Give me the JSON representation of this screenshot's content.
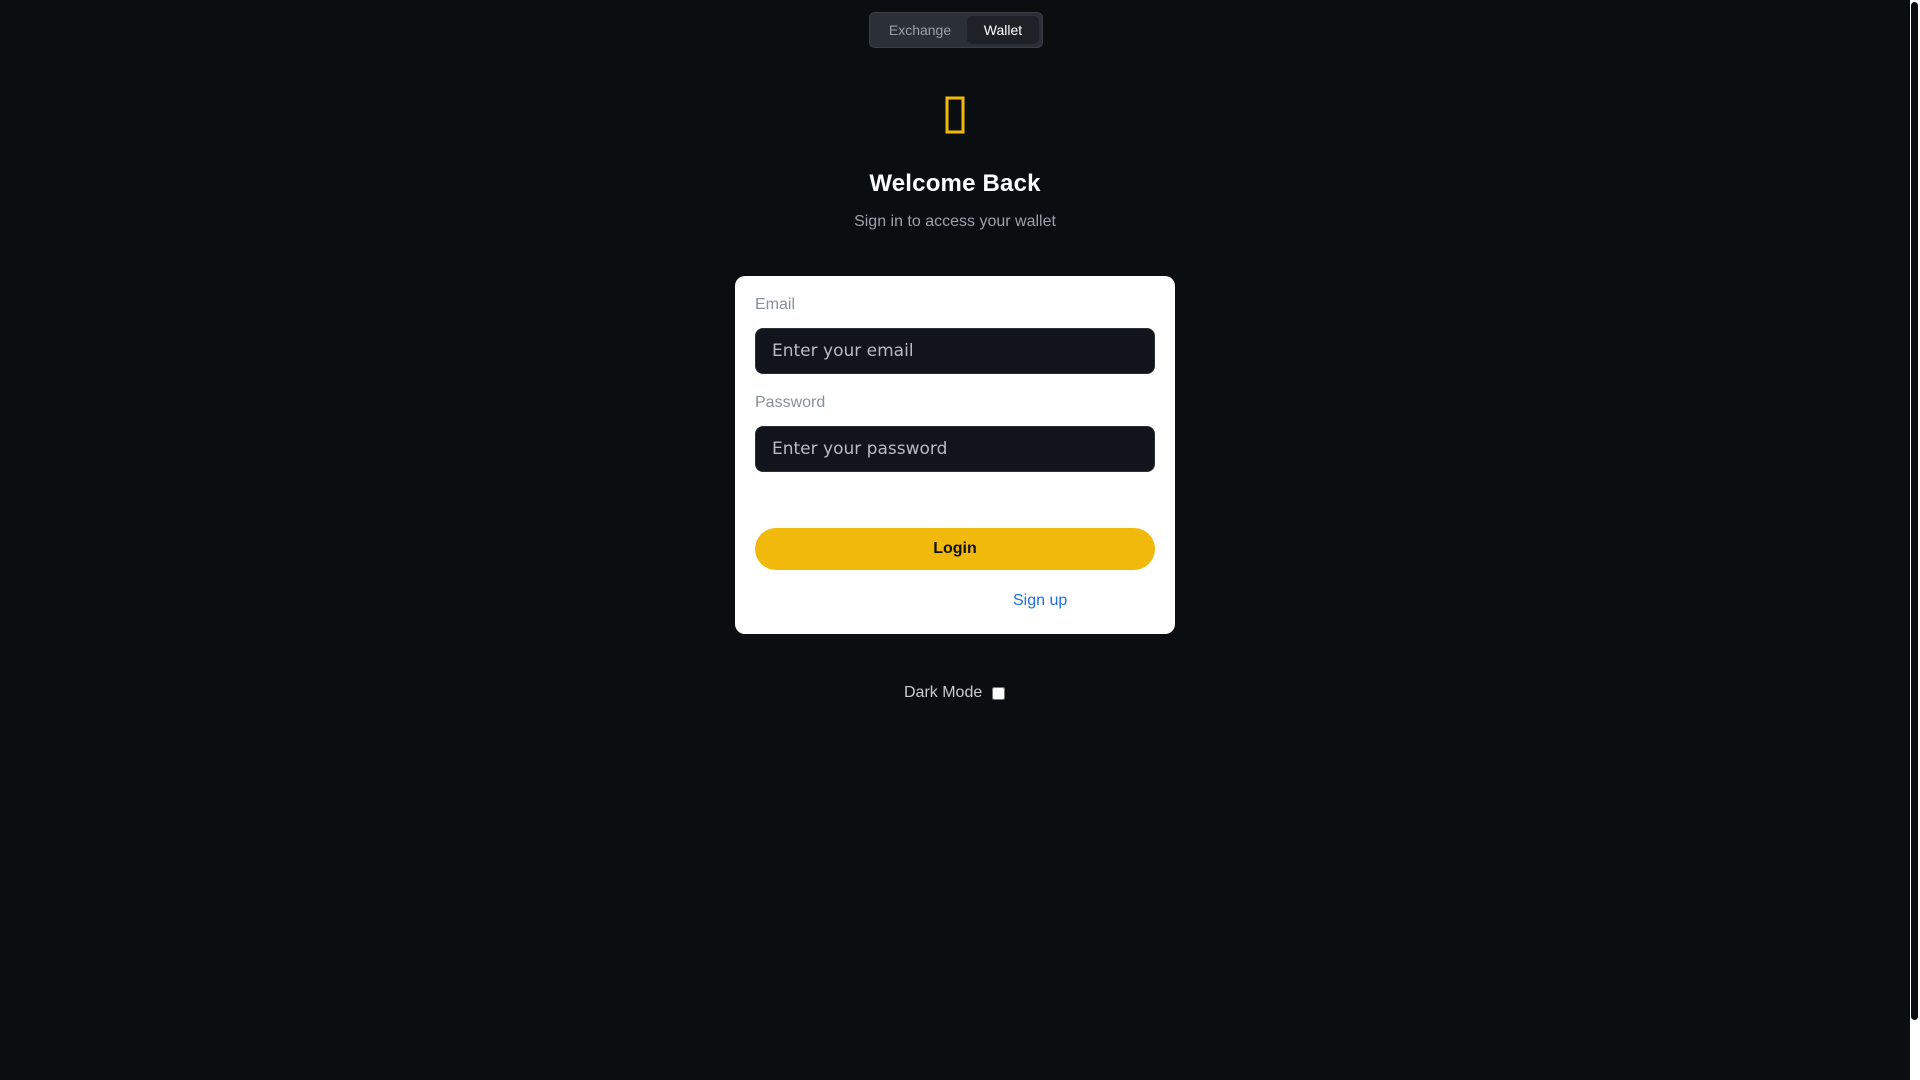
{
  "mode_toggle": {
    "tabs": [
      {
        "label": "Exchange",
        "active": false
      },
      {
        "label": "Wallet",
        "active": true
      }
    ]
  },
  "header": {
    "logo_icon": "wallet-icon",
    "title": "Welcome Back",
    "subtitle": "Sign in to access your wallet"
  },
  "form": {
    "email_label": "Email",
    "email_placeholder": "Enter your email",
    "email_value": "",
    "password_label": "Password",
    "password_placeholder": "Enter your password",
    "password_value": "",
    "login_label": "Login",
    "signup_label": "Sign up"
  },
  "settings": {
    "dark_mode_label": "Dark Mode",
    "dark_mode_checked": false
  },
  "colors": {
    "background": "#0b0e11",
    "accent": "#f0b90b",
    "link": "#1f6fe0",
    "card": "#ffffff"
  }
}
